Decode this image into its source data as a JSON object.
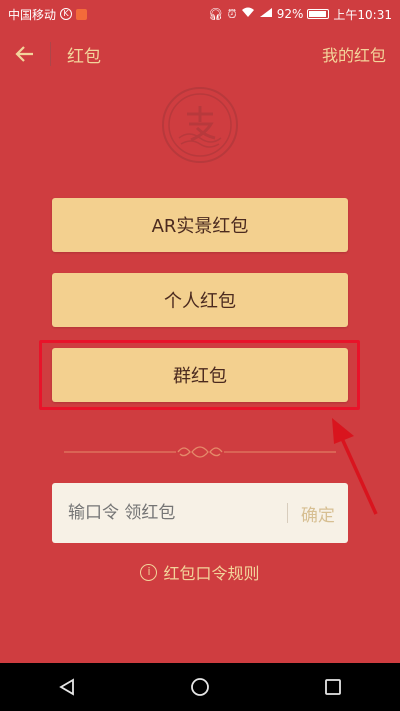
{
  "status_bar": {
    "carrier": "中国移动",
    "battery": "92%",
    "time": "上午10:31",
    "signal_text": "⁴G"
  },
  "header": {
    "title": "红包",
    "right_link": "我的红包"
  },
  "buttons": {
    "ar": "AR实景红包",
    "personal": "个人红包",
    "group": "群红包"
  },
  "code": {
    "placeholder": "输口令 领红包",
    "confirm": "确定"
  },
  "rules": {
    "label": "红包口令规则"
  },
  "colors": {
    "background": "#cf3d40",
    "button": "#f3d08f",
    "accent_text": "#f3d49b",
    "highlight": "#e8132a"
  }
}
